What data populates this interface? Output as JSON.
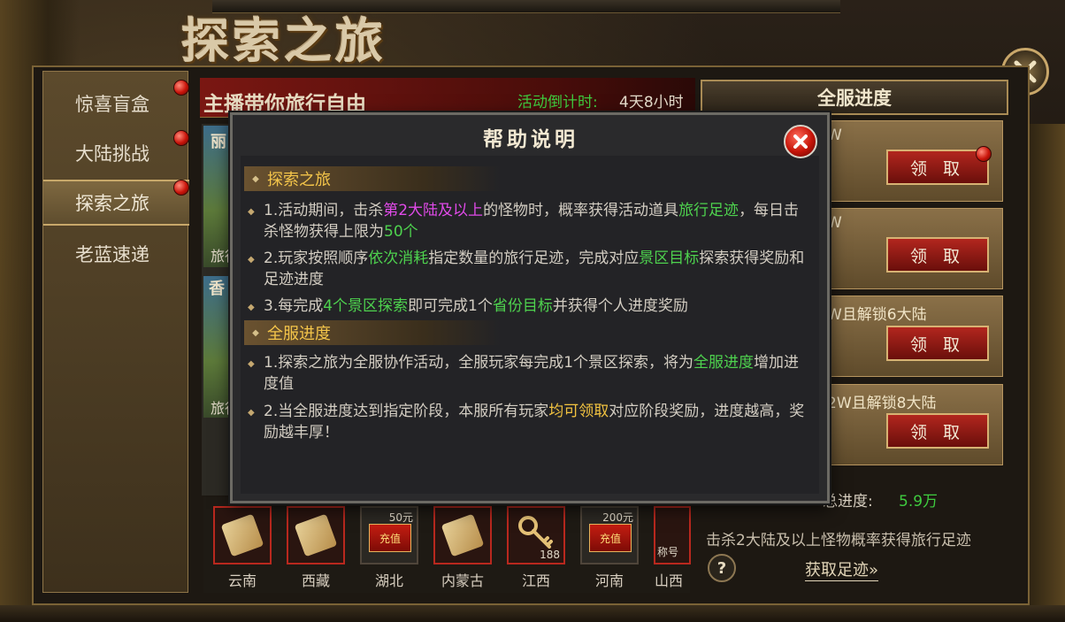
{
  "title": "探索之旅",
  "sidebar": {
    "items": [
      {
        "label": "惊喜盲盒"
      },
      {
        "label": "大陆挑战"
      },
      {
        "label": "探索之旅"
      },
      {
        "label": "老蓝速递"
      }
    ]
  },
  "header": {
    "subtitle": "主播带你旅行自由",
    "countdown_label": "活动倒计时:",
    "countdown_value": "4天8小时",
    "server_tab": "全服进度"
  },
  "left_cards": {
    "card1_title": "丽",
    "card1_caption": "旅行",
    "card2_title": "香",
    "card2_caption": "旅行"
  },
  "rewards": [
    {
      "caption": "W",
      "button": "领 取"
    },
    {
      "caption": "W",
      "button": "领 取"
    },
    {
      "caption": "W且解锁6大陆",
      "button": "领 取"
    },
    {
      "caption": "2W且解锁8大陆",
      "button": "领 取"
    }
  ],
  "footer_right": {
    "total_label": "总进度:",
    "total_value": "5.9万",
    "hint": "击杀2大陆及以上怪物概率获得旅行足迹",
    "help_symbol": "?",
    "get_link": "获取足迹»"
  },
  "items": [
    {
      "label": "云南",
      "kind": "scroll"
    },
    {
      "label": "西藏",
      "kind": "scroll"
    },
    {
      "label": "湖北",
      "kind": "card",
      "card_text": "充值",
      "amount": "50元"
    },
    {
      "label": "内蒙古",
      "kind": "scroll"
    },
    {
      "label": "江西",
      "kind": "key",
      "count": "188"
    },
    {
      "label": "河南",
      "kind": "card",
      "card_text": "充值",
      "amount": "200元"
    },
    {
      "label": "山西",
      "kind": "badge",
      "badge_text": "称号"
    }
  ],
  "modal": {
    "title": "帮助说明",
    "section1": {
      "heading": "探索之旅",
      "p1": {
        "a": "1.活动期间，击杀",
        "b": "第2大陆及以上",
        "c": "的怪物时，概率获得活动道具",
        "d": "旅行足迹",
        "e": "，每日击杀怪物获得上限为",
        "f": "50个"
      },
      "p2": {
        "a": "2.玩家按照顺序",
        "b": "依次消耗",
        "c": "指定数量的旅行足迹，完成对应",
        "d": "景区目标",
        "e": "探索获得奖励和足迹进度"
      },
      "p3": {
        "a": "3.每完成",
        "b": "4个景区探索",
        "c": "即可完成1个",
        "d": "省份目标",
        "e": "并获得个人进度奖励"
      }
    },
    "section2": {
      "heading": "全服进度",
      "p1": {
        "a": "1.探索之旅为全服协作活动，全服玩家每完成1个景区探索，将为",
        "b": "全服进度",
        "c": "增加进度值"
      },
      "p2": {
        "a": "2.当全服进度达到指定阶段，本服所有玩家",
        "b": "均可领取",
        "c": "对应阶段奖励，进度越高，奖励越丰厚！"
      }
    }
  }
}
